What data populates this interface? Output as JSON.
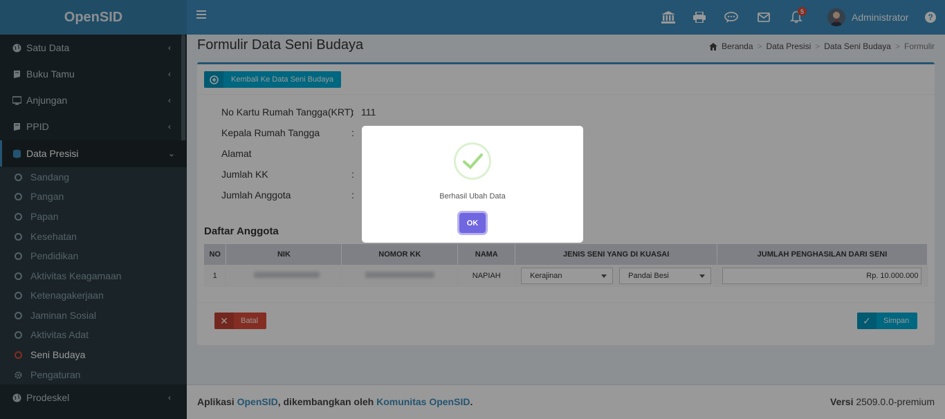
{
  "app": {
    "logo": "OpenSID"
  },
  "header": {
    "user_name": "Administrator",
    "notifications": "5"
  },
  "sidebar": {
    "items": [
      {
        "label": "Satu Data",
        "icon": "globe-icon"
      },
      {
        "label": "Buku Tamu",
        "icon": "book-icon"
      },
      {
        "label": "Anjungan",
        "icon": "monitor-icon"
      },
      {
        "label": "PPID",
        "icon": "book-icon"
      },
      {
        "label": "Data Presisi",
        "icon": "database-icon"
      }
    ],
    "sub_items": [
      {
        "label": "Sandang"
      },
      {
        "label": "Pangan"
      },
      {
        "label": "Papan"
      },
      {
        "label": "Kesehatan"
      },
      {
        "label": "Pendidikan"
      },
      {
        "label": "Aktivitas Keagamaan"
      },
      {
        "label": "Ketenagakerjaan"
      },
      {
        "label": "Jaminan Sosial"
      },
      {
        "label": "Aktivitas Adat"
      },
      {
        "label": "Seni Budaya"
      },
      {
        "label": "Pengaturan"
      }
    ],
    "bottom_item": {
      "label": "Prodeskel"
    }
  },
  "page": {
    "title": "Formulir Data Seni Budaya",
    "breadcrumb": [
      "Beranda",
      "Data Presisi",
      "Data Seni Budaya",
      "Formulir"
    ]
  },
  "form": {
    "back_button": "Kembali Ke Data Seni Budaya",
    "info": [
      {
        "label": "No Kartu Rumah Tangga(KRT)",
        "value": "111"
      },
      {
        "label": "Kepala Rumah Tangga",
        "value": ""
      },
      {
        "label": "Alamat",
        "value": ""
      },
      {
        "label": "Jumlah KK",
        "value": ""
      },
      {
        "label": "Jumlah Anggota",
        "value": ""
      }
    ],
    "section_title": "Daftar Anggota",
    "table": {
      "headers": [
        "NO",
        "NIK",
        "NOMOR KK",
        "NAMA",
        "JENIS SENI YANG DI KUASAI",
        "JUMLAH PENGHASILAN DARI SENI"
      ],
      "rows": [
        {
          "no": "1",
          "nama": "NAPIAH",
          "jenis1": "Kerajinan",
          "jenis2": "Pandai Besi",
          "penghasilan": "Rp. 10.000.000"
        }
      ]
    },
    "cancel_button": "Batal",
    "save_button": "Simpan"
  },
  "footer": {
    "prefix": "Aplikasi ",
    "app_link": "OpenSID",
    "middle": ", dikembangkan oleh ",
    "community_link": "Komunitas OpenSID",
    "suffix": ".",
    "version_label": "Versi",
    "version": "2509.0.0-premium"
  },
  "modal": {
    "message": "Berhasil Ubah Data",
    "ok_label": "OK"
  }
}
